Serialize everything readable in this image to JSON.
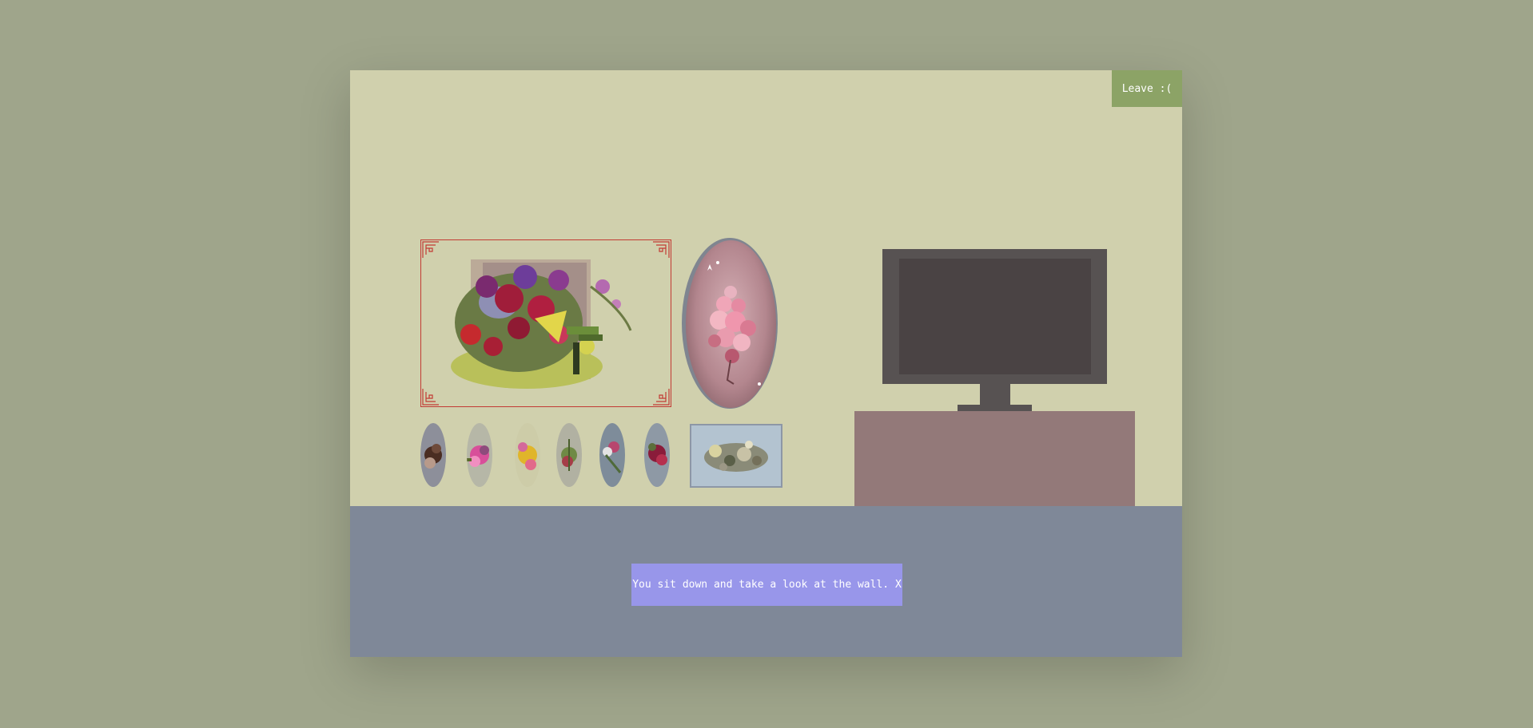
{
  "room": {
    "leave_label": "Leave :(",
    "dialog_text": "You sit down and take a look at the wall. X"
  },
  "colors": {
    "background": "#9fa58b",
    "wall": "#d0d0ad",
    "floor": "#7f8898",
    "leave_button": "#8ca366",
    "dialog": "#9896ea",
    "frame_red": "#c23a34",
    "tv": "#575252",
    "tv_screen": "#4a4344",
    "tv_stand": "#937979"
  },
  "artworks": [
    {
      "name": "main-flower-painting",
      "frame": "red-ornate-rectangle"
    },
    {
      "name": "oval-pink-bouquet",
      "frame": "grey-oval"
    },
    {
      "name": "small-oval-1",
      "frame": "oval"
    },
    {
      "name": "small-oval-2",
      "frame": "oval"
    },
    {
      "name": "small-oval-3",
      "frame": "oval"
    },
    {
      "name": "small-oval-4",
      "frame": "oval"
    },
    {
      "name": "small-oval-5",
      "frame": "oval"
    },
    {
      "name": "small-oval-6",
      "frame": "oval"
    },
    {
      "name": "small-rect-painting",
      "frame": "grey-rectangle"
    }
  ]
}
